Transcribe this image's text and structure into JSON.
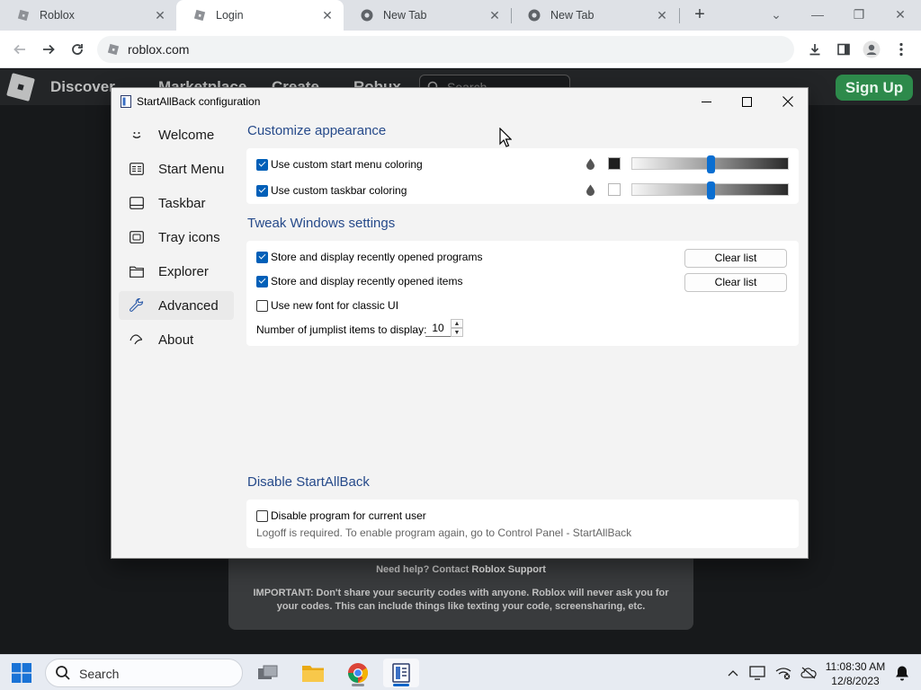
{
  "browser": {
    "tabs": [
      {
        "title": "Roblox",
        "icon": "roblox-favicon"
      },
      {
        "title": "Login",
        "icon": "roblox-favicon",
        "active": true
      },
      {
        "title": "New Tab",
        "icon": "chrome-icon"
      },
      {
        "title": "New Tab",
        "icon": "chrome-icon"
      }
    ],
    "new_tab": "+",
    "url": "roblox.com"
  },
  "roblox": {
    "nav": [
      "Discover",
      "Marketplace",
      "Create",
      "Robux"
    ],
    "search_placeholder": "Search",
    "signup": "Sign Up",
    "help_prefix": "Need help? Contact",
    "help_link": "Roblox Support",
    "important": "IMPORTANT: Don't share your security codes with anyone. Roblox will never ask you for your codes. This can include things like texting your code, screensharing, etc."
  },
  "sab": {
    "title": "StartAllBack configuration",
    "sidebar": [
      {
        "label": "Welcome",
        "icon": "smile-icon"
      },
      {
        "label": "Start Menu",
        "icon": "start-menu-icon"
      },
      {
        "label": "Taskbar",
        "icon": "taskbar-icon"
      },
      {
        "label": "Tray icons",
        "icon": "tray-icon"
      },
      {
        "label": "Explorer",
        "icon": "folder-icon"
      },
      {
        "label": "Advanced",
        "icon": "wrench-icon",
        "selected": true
      },
      {
        "label": "About",
        "icon": "about-icon"
      }
    ],
    "appearance": {
      "heading": "Customize appearance",
      "start_menu_coloring": {
        "label": "Use custom start menu coloring",
        "checked": true,
        "swatch": "#1f1f1f",
        "slider_value": 0.5
      },
      "taskbar_coloring": {
        "label": "Use custom taskbar coloring",
        "checked": true,
        "swatch": "#ffffff",
        "slider_value": 0.5
      }
    },
    "tweak": {
      "heading": "Tweak Windows settings",
      "recent_programs": {
        "label": "Store and display recently opened programs",
        "checked": true
      },
      "recent_items": {
        "label": "Store and display recently opened items",
        "checked": true
      },
      "new_font": {
        "label": "Use new font for classic UI",
        "checked": false
      },
      "jumplist_label": "Number of jumplist items to display:",
      "jumplist_value": "10",
      "clear_list": "Clear list"
    },
    "disable": {
      "heading": "Disable StartAllBack",
      "label": "Disable program for current user",
      "checked": false,
      "note": "Logoff is required. To enable program again, go to Control Panel - StartAllBack"
    }
  },
  "taskbar": {
    "search": "Search",
    "apps": [
      "task-view-icon",
      "file-explorer-icon",
      "chrome-icon",
      "startallback-icon"
    ],
    "time": "11:08:30 AM",
    "date": "12/8/2023"
  },
  "colors": {
    "accent": "#005fb8",
    "heading": "#264a8a",
    "roblox_green": "#2d8a4b"
  }
}
